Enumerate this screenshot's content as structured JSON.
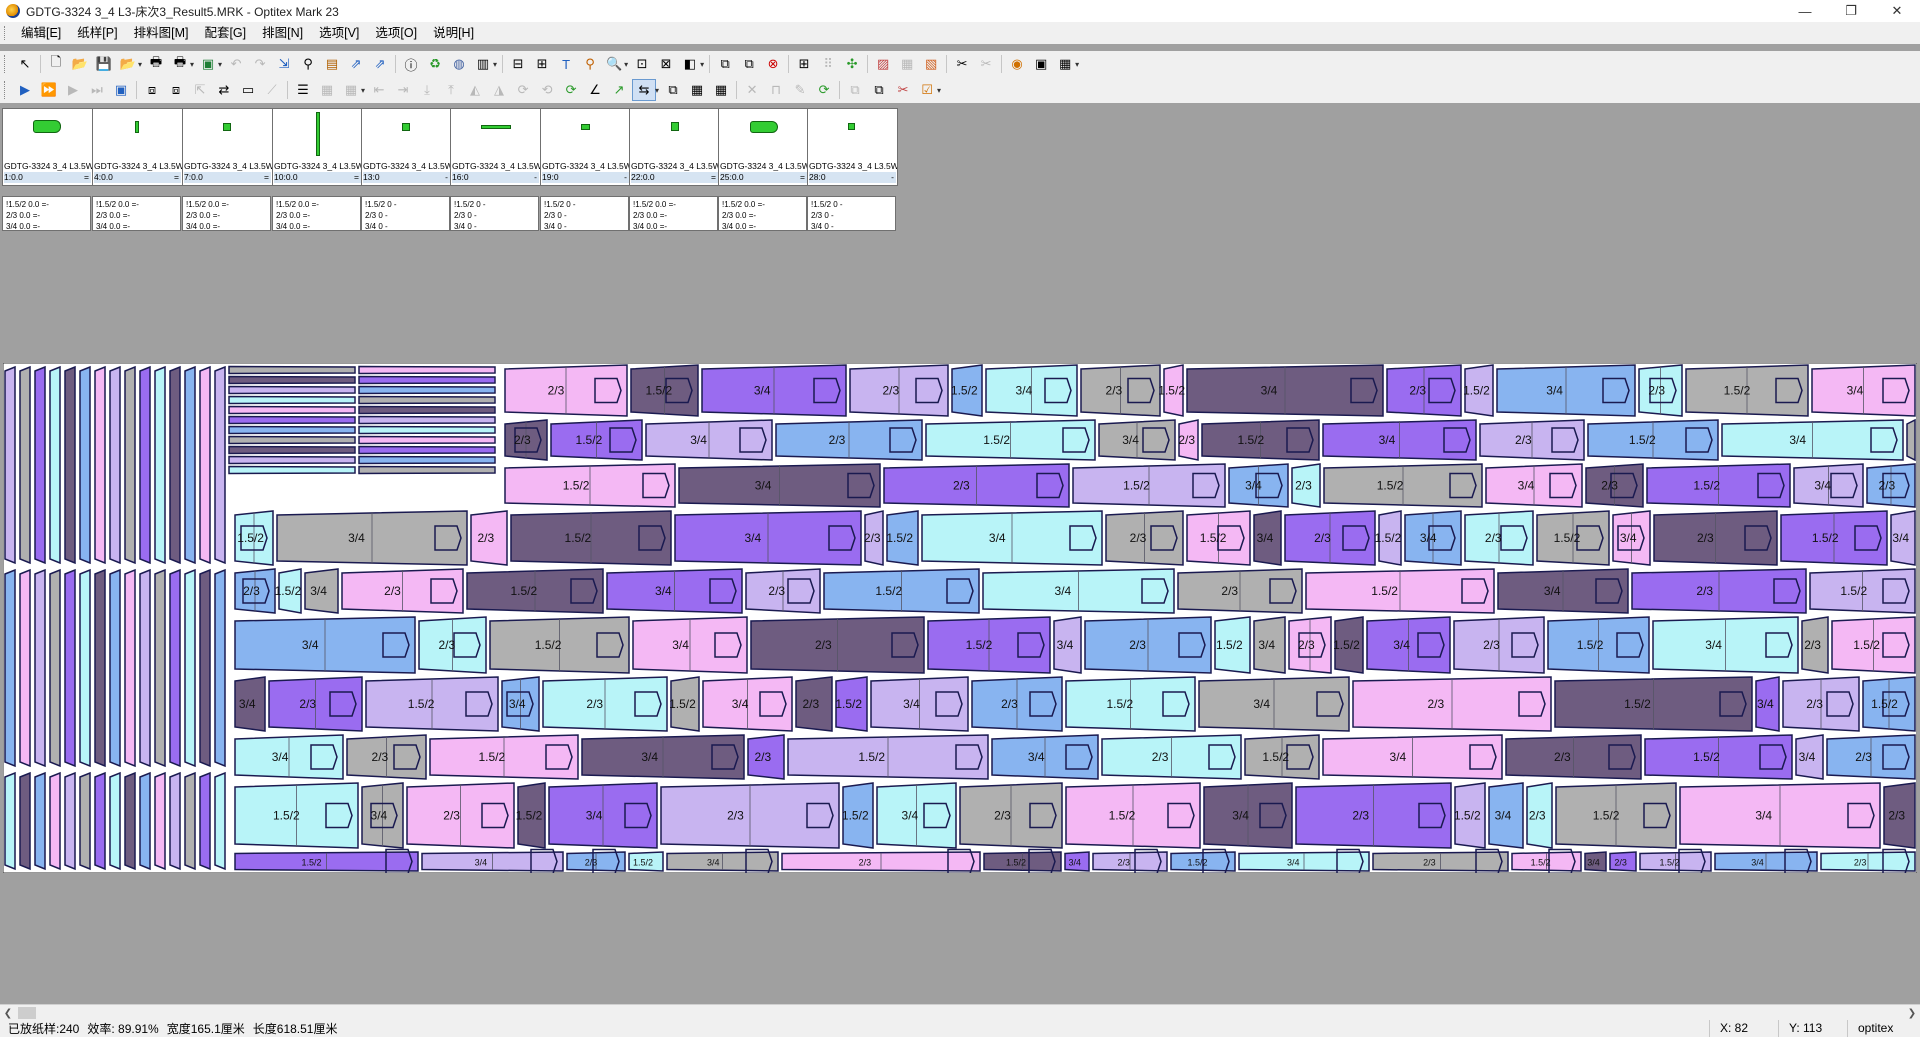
{
  "window": {
    "title": "GDTG-3324 3_4 L3-床次3_Result5.MRK - Optitex Mark 23",
    "controls": [
      "—",
      "❐",
      "✕"
    ]
  },
  "menu": [
    "编辑[E]",
    "纸样[P]",
    "排料图[M]",
    "配套[G]",
    "排图[N]",
    "选项[V]",
    "选项[O]",
    "说明[H]"
  ],
  "piece_bank": [
    {
      "name": "GDTG-3324 3_4 L3.5W",
      "pos": "1:0.0",
      "flag": "="
    },
    {
      "name": "GDTG-3324 3_4 L3.5W",
      "pos": "4:0.0",
      "flag": "="
    },
    {
      "name": "GDTG-3324 3_4 L3.5W",
      "pos": "7:0.0",
      "flag": "="
    },
    {
      "name": "GDTG-3324 3_4 L3.5W",
      "pos": "10:0.0",
      "flag": "="
    },
    {
      "name": "GDTG-3324 3_4 L3.5W",
      "pos": "13:0",
      "flag": "-"
    },
    {
      "name": "GDTG-3324 3_4 L3.5W",
      "pos": "16:0",
      "flag": "-"
    },
    {
      "name": "GDTG-3324 3_4 L3.5W",
      "pos": "19:0",
      "flag": "-"
    },
    {
      "name": "GDTG-3324 3_4 L3.5W",
      "pos": "22:0.0",
      "flag": "="
    },
    {
      "name": "GDTG-3324 3_4 L3.5W",
      "pos": "25:0.0",
      "flag": "="
    },
    {
      "name": "GDTG-3324 3_4 L3.5W",
      "pos": "28:0",
      "flag": "-"
    }
  ],
  "size_lists": [
    [
      "!1.5/2 0.0 =-",
      " 2/3 0.0 =-",
      " 3/4 0.0 =-"
    ],
    [
      "!1.5/2 0.0 =-",
      " 2/3 0.0 =-",
      " 3/4 0.0 =-"
    ],
    [
      "!1.5/2 0.0 =-",
      " 2/3 0.0 =-",
      " 3/4 0.0 =-"
    ],
    [
      "!1.5/2 0.0 =-",
      " 2/3 0.0 =-",
      " 3/4 0.0 =-"
    ],
    [
      "!1.5/2 0  -",
      " 2/3 0  -",
      " 3/4 0  -"
    ],
    [
      "!1.5/2 0  -",
      " 2/3 0  -",
      " 3/4 0  -"
    ],
    [
      "!1.5/2 0  -",
      " 2/3 0  -",
      " 3/4 0  -"
    ],
    [
      "!1.5/2 0.0 =-",
      " 2/3 0.0 =-",
      " 3/4 0.0 =-"
    ],
    [
      "!1.5/2 0.0 =-",
      " 2/3 0.0 =-",
      " 3/4 0.0 =-"
    ],
    [
      "!1.5/2 0  -",
      " 2/3 0  -",
      " 3/4 0  -"
    ]
  ],
  "size_labels": [
    "3/4",
    "2/3",
    "1.5/2"
  ],
  "size_colors": {
    "3/4": "#c8b4f0",
    "2/3": "#88b4f0",
    "1.5/2": "#b8f4f8",
    "alt1": "#b0b0b0",
    "alt2": "#f4b8f4",
    "alt3": "#6e5c80",
    "alt4": "#9a6cf0"
  },
  "status": {
    "placed": "已放纸样:240",
    "efficiency": "效率: 89.91%",
    "width": "宽度165.1厘米",
    "length": "长度618.51厘米",
    "x": "X: 82",
    "y": "Y: 113",
    "brand": "optitex"
  }
}
